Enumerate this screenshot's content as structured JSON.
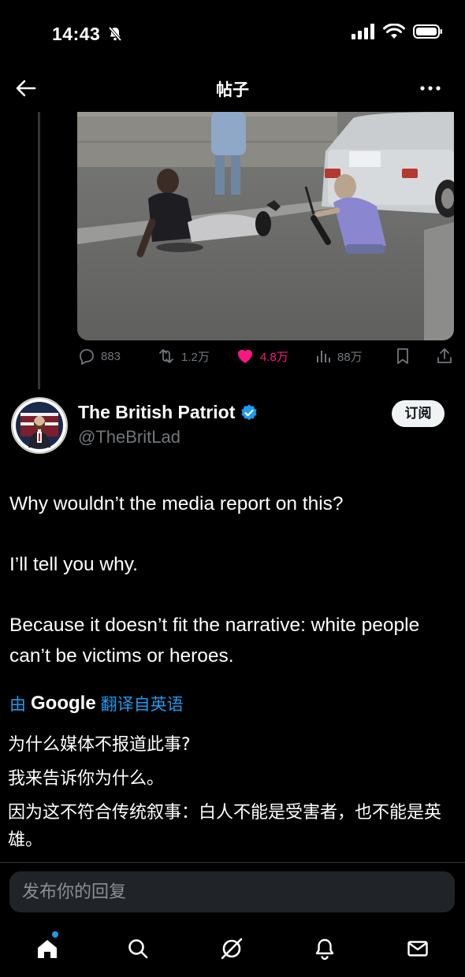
{
  "status_bar": {
    "time": "14:43"
  },
  "header": {
    "title": "帖子"
  },
  "post_actions": {
    "replies": "883",
    "reposts": "1.2万",
    "likes": "4.8万",
    "views": "88万"
  },
  "author": {
    "name": "The British Patriot",
    "handle": "@TheBritLad",
    "subscribe_label": "订阅"
  },
  "post": {
    "paragraphs": [
      "Why wouldn’t the media report on this?",
      "I’ll tell you why.",
      "Because it doesn’t fit the narrative: white people can’t be victims or heroes."
    ]
  },
  "translation": {
    "prefix": "由",
    "provider": "Google",
    "label": "翻译自英语",
    "lines": [
      "为什么媒体不报道此事?",
      "我来告诉你为什么。",
      "因为这不符合传统叙事：白人不能是受害者，也不能是英雄。"
    ]
  },
  "reply": {
    "placeholder": "发布你的回复"
  },
  "colors": {
    "accent": "#1d9bf0",
    "like": "#f91880",
    "muted": "#71767b",
    "verified": "#1d9bf0"
  },
  "icons": {
    "tabs": [
      "home-icon",
      "search-icon",
      "grok-icon",
      "notifications-icon",
      "messages-icon"
    ]
  }
}
